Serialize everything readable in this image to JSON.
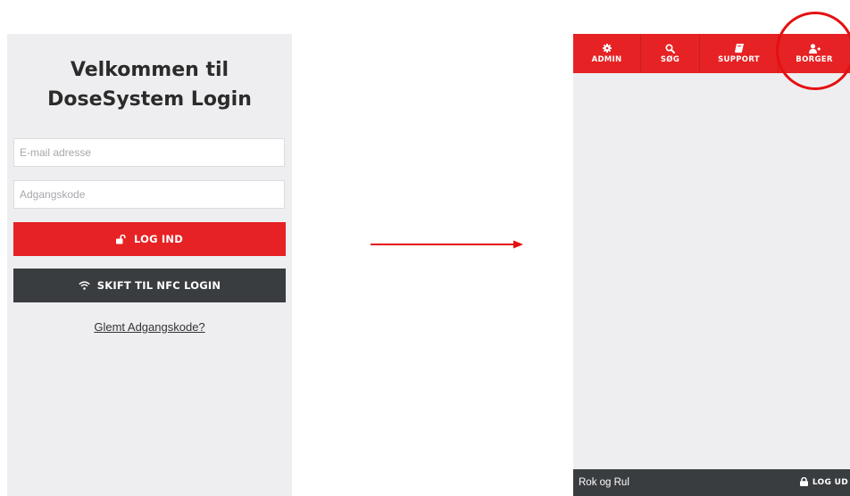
{
  "login": {
    "title_line1": "Velkommen til",
    "title_line2": "DoseSystem Login",
    "email_placeholder": "E-mail adresse",
    "password_placeholder": "Adgangskode",
    "login_button": {
      "label": "LOG IND",
      "icon": "unlock-icon"
    },
    "nfc_button": {
      "label": "SKIFT TIL NFC LOGIN",
      "icon": "wifi-icon"
    },
    "forgot_link": "Glemt Adgangskode?"
  },
  "app": {
    "nav": [
      {
        "label": "ADMIN",
        "icon": "gear-icon"
      },
      {
        "label": "SØG",
        "icon": "search-icon"
      },
      {
        "label": "SUPPORT",
        "icon": "book-icon"
      },
      {
        "label": "BORGER",
        "icon": "add-user-icon"
      }
    ],
    "footer": {
      "user": "Rok og Rul",
      "logout_label": "LOG UD",
      "logout_icon": "lock-icon"
    }
  },
  "colors": {
    "accent": "#e62224",
    "dark": "#3a3d40",
    "panel": "#eeeef1",
    "annotation": "#e51010"
  }
}
